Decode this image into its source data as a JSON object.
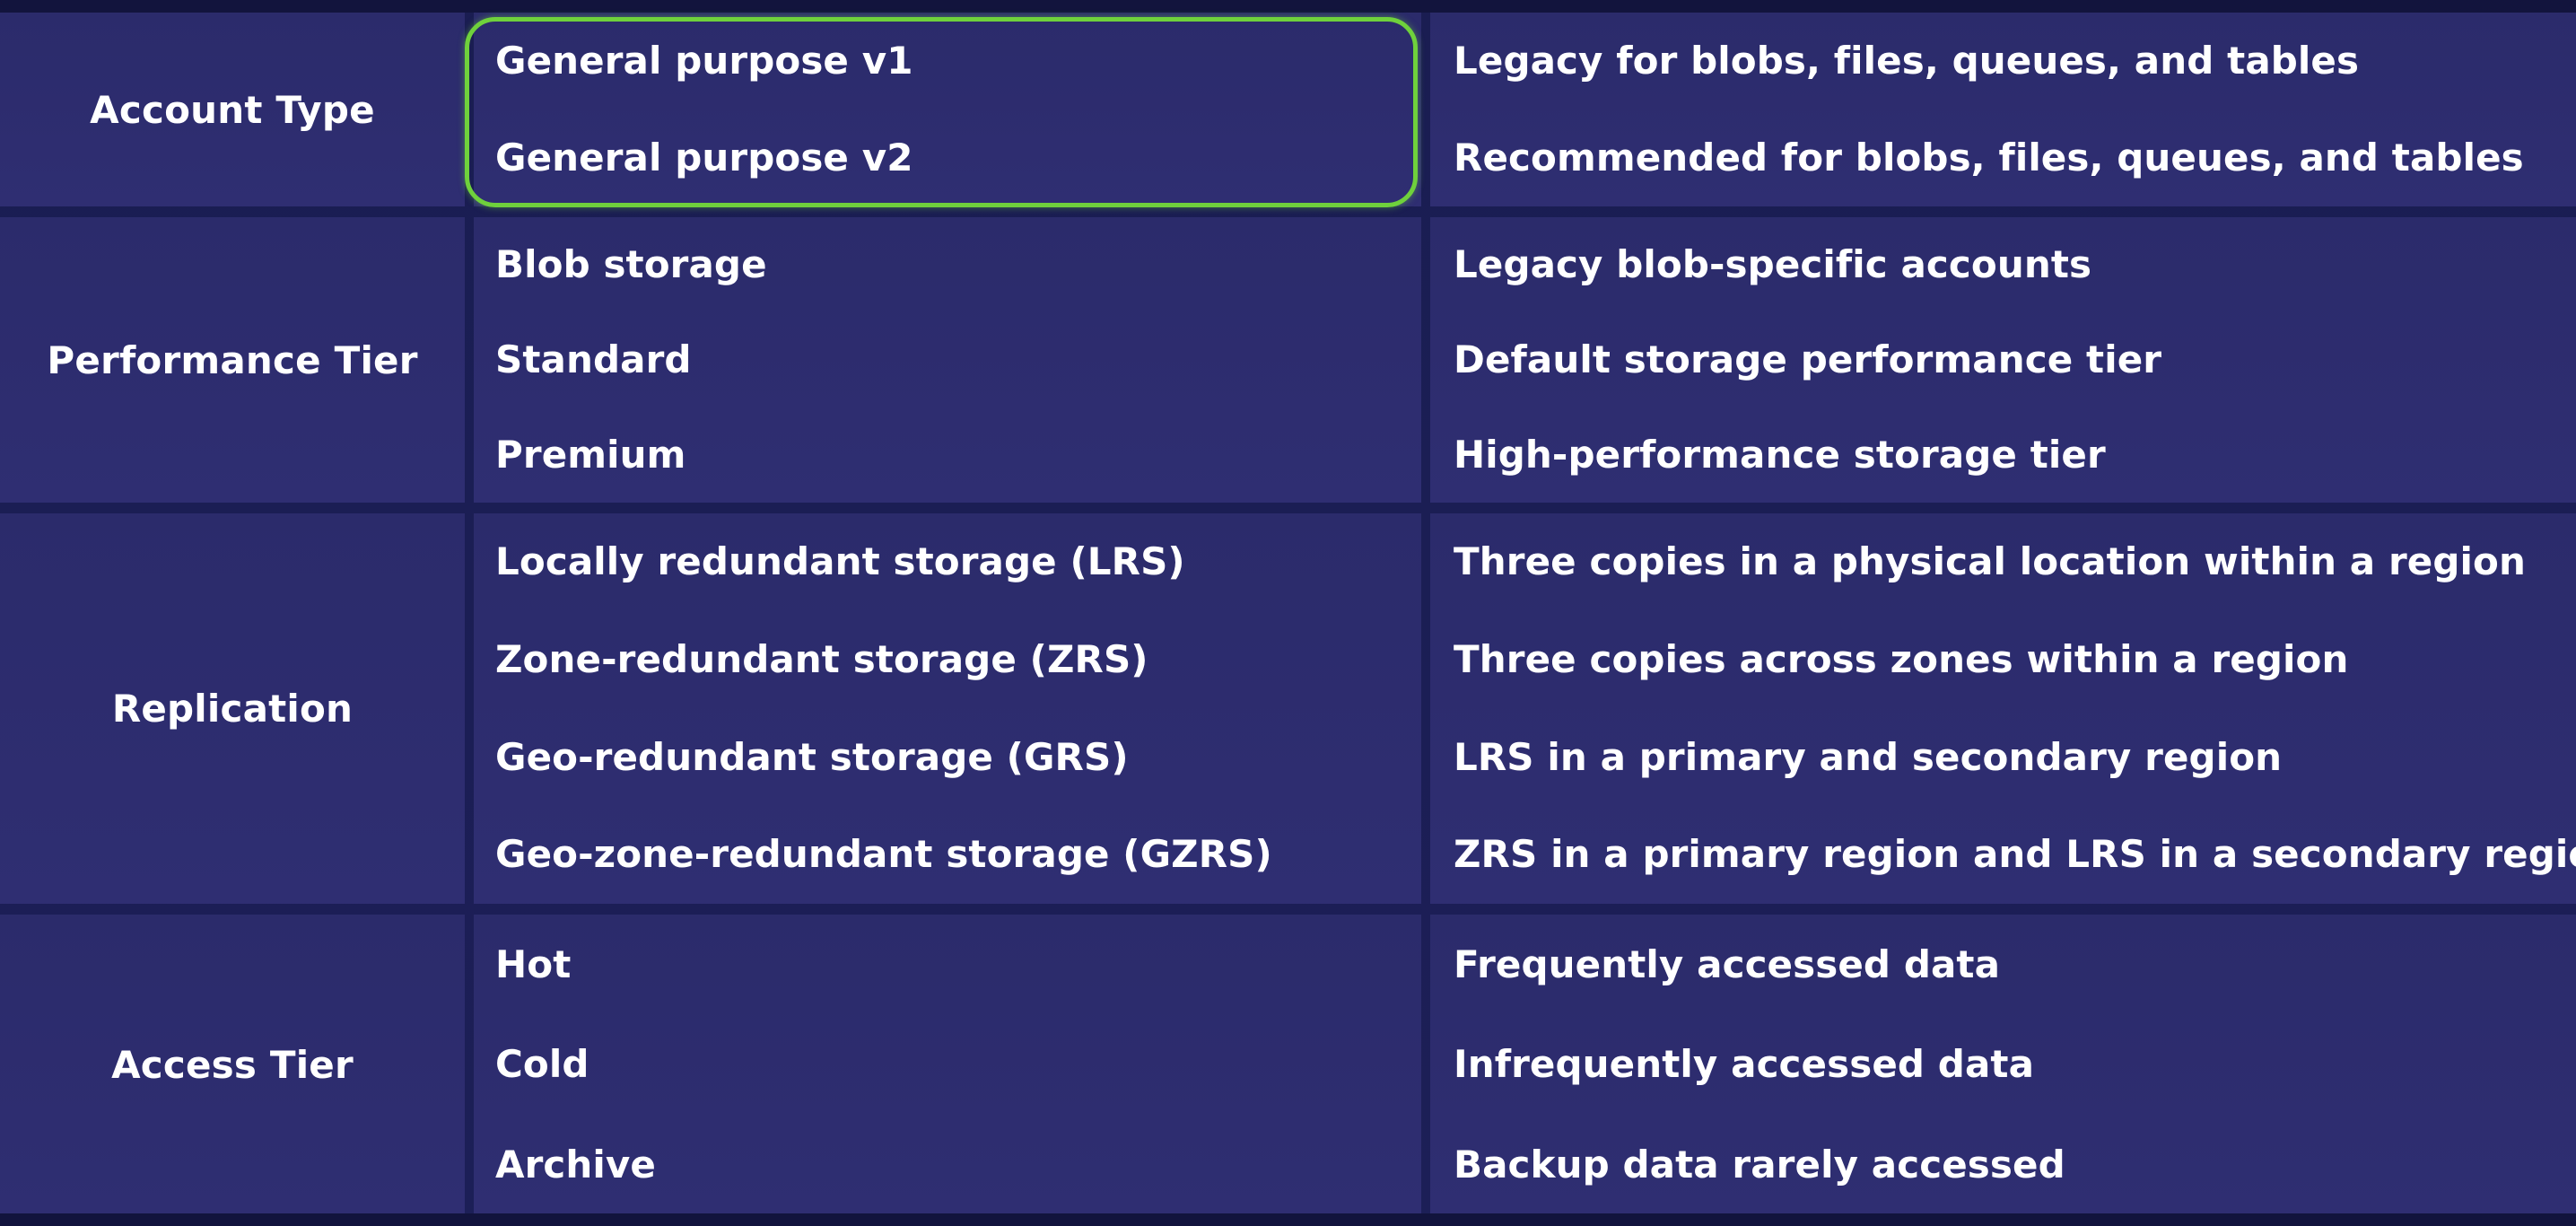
{
  "colors": {
    "background": "#1a1d52",
    "cell": "#2d2d70",
    "highlight": "#6fd13c",
    "text": "#ffffff"
  },
  "table": {
    "rows": [
      {
        "category": "Account Type",
        "options": [
          "General purpose v1",
          "General purpose v2"
        ],
        "descriptions": [
          "Legacy for blobs, files, queues, and tables",
          "Recommended for blobs, files, queues, and tables"
        ]
      },
      {
        "category": "Performance Tier",
        "options": [
          "Blob storage",
          "Standard",
          "Premium"
        ],
        "descriptions": [
          "Legacy blob-specific accounts",
          "Default storage performance tier",
          "High-performance storage tier"
        ]
      },
      {
        "category": "Replication",
        "options": [
          "Locally redundant storage (LRS)",
          "Zone-redundant storage (ZRS)",
          "Geo-redundant storage (GRS)",
          "Geo-zone-redundant storage (GZRS)"
        ],
        "descriptions": [
          "Three copies in a physical location within a region",
          "Three copies across zones within a region",
          "LRS in a primary and secondary region",
          "ZRS in a primary region and LRS in a secondary region"
        ]
      },
      {
        "category": "Access Tier",
        "options": [
          "Hot",
          "Cold",
          "Archive"
        ],
        "descriptions": [
          "Frequently accessed data",
          "Infrequently accessed data",
          "Backup data rarely accessed"
        ]
      }
    ]
  }
}
